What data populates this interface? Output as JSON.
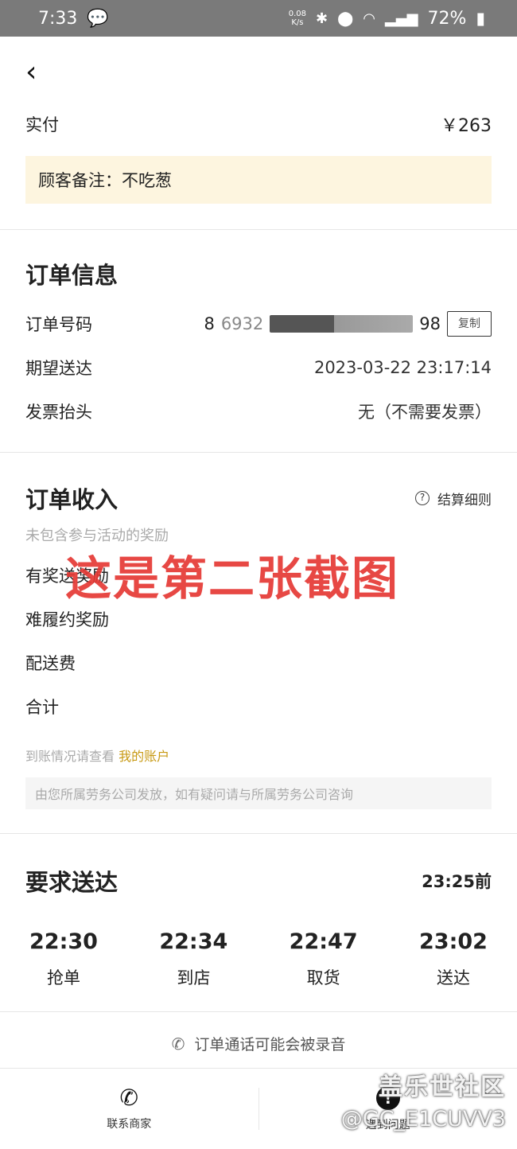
{
  "status_bar": {
    "time": "7:33",
    "net_speed_value": "0.08",
    "net_speed_unit": "K/s",
    "battery": "72%",
    "icons": [
      "wechat-icon",
      "bluetooth-icon",
      "location-icon",
      "wifi-icon",
      "signal-icon",
      "battery-icon"
    ]
  },
  "header": {
    "back_icon": "back-arrow-icon"
  },
  "payment": {
    "label": "实付",
    "value": "￥263",
    "note": "顾客备注：不吃葱"
  },
  "order_info": {
    "title": "订单信息",
    "rows": [
      {
        "label": "订单号码",
        "value_prefix": "8",
        "value_partial": "6932",
        "value_suffix": "98",
        "copy_label": "复制"
      },
      {
        "label": "期望送达",
        "value": "2023-03-22 23:17:14"
      },
      {
        "label": "发票抬头",
        "value": "无（不需要发票）"
      }
    ]
  },
  "income": {
    "title": "订单收入",
    "rules_link": "结算细则",
    "subtitle": "未包含参与活动的奖励",
    "rows": [
      {
        "label": "有奖送奖励"
      },
      {
        "label": "难履约奖励"
      },
      {
        "label": "配送费"
      },
      {
        "label": "合计"
      }
    ],
    "account_text": "到账情况请查看",
    "account_link": "我的账户",
    "disclaimer": "由您所属劳务公司发放，如有疑问请与所属劳务公司咨询"
  },
  "overlay": {
    "text": "这是第二张截图",
    "color": "#e53935"
  },
  "delivery": {
    "title": "要求送达",
    "deadline": "23:25前",
    "steps": [
      {
        "time": "22:30",
        "label": "抢单"
      },
      {
        "time": "22:34",
        "label": "到店"
      },
      {
        "time": "22:47",
        "label": "取货"
      },
      {
        "time": "23:02",
        "label": "送达"
      }
    ]
  },
  "record_notice": "订单通话可能会被录音",
  "bottom_bar": {
    "contact_label": "联系商家",
    "problem_label": "遇到问题"
  },
  "watermark": {
    "line1": "盖乐世社区",
    "line2": "@GC_E1CUVV3"
  },
  "colors": {
    "accent_link": "#c89a14",
    "note_bg": "#fdf5df",
    "status_bar_bg": "#7a7a7a"
  }
}
